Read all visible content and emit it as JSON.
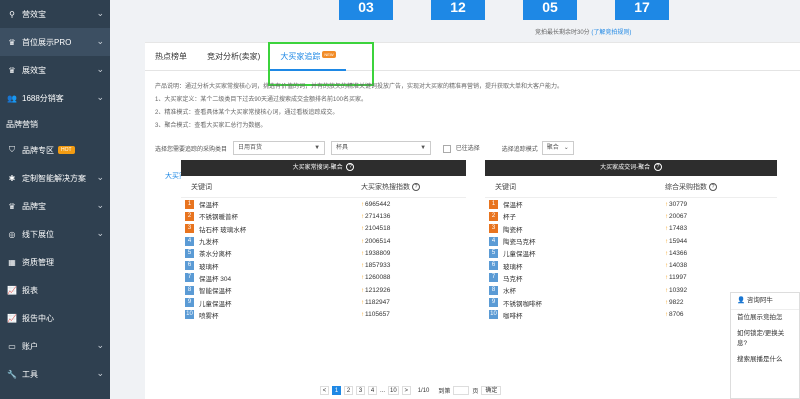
{
  "sidebar": {
    "items": [
      {
        "icon": "search-icon",
        "label": "营效宝",
        "chev": "chevron-down-icon",
        "type": "item"
      },
      {
        "icon": "crown-icon",
        "label": "首位展示PRO",
        "chev": "chevron-down-icon",
        "type": "item",
        "active": true
      },
      {
        "icon": "crown-icon",
        "label": "展效宝",
        "chev": "chevron-down-icon",
        "type": "item"
      },
      {
        "icon": "users-icon",
        "label": "1688分销客",
        "chev": "chevron-down-icon",
        "type": "item"
      },
      {
        "icon": "",
        "label": "品牌营销",
        "chev": "",
        "type": "section"
      },
      {
        "icon": "shield-icon",
        "label": "品牌专区",
        "badge": "HOT",
        "chev": "",
        "type": "item"
      },
      {
        "icon": "bulb-icon",
        "label": "定制智能解决方案",
        "chev": "chevron-down-icon",
        "type": "item"
      },
      {
        "icon": "crown-icon",
        "label": "品牌宝",
        "chev": "chevron-down-icon",
        "type": "item"
      },
      {
        "icon": "target-icon",
        "label": "线下展位",
        "chev": "chevron-down-icon",
        "type": "item"
      },
      {
        "icon": "grid-icon",
        "label": "资质管理",
        "chev": "",
        "type": "item"
      },
      {
        "icon": "chart-icon",
        "label": "报表",
        "chev": "",
        "type": "item"
      },
      {
        "icon": "chart-icon",
        "label": "报告中心",
        "chev": "",
        "type": "item"
      },
      {
        "icon": "wallet-icon",
        "label": "账户",
        "chev": "chevron-down-icon",
        "type": "item"
      },
      {
        "icon": "wrench-icon",
        "label": "工具",
        "chev": "chevron-down-icon",
        "type": "item"
      }
    ]
  },
  "timer": {
    "digits": [
      "03",
      "12",
      "05",
      "17"
    ],
    "note": "竞拍最长剩余时30分",
    "note_link": "(了解竞拍规则)"
  },
  "tabs": [
    {
      "label": "热点榜单"
    },
    {
      "label": "竞对分析(卖家)"
    },
    {
      "label": "大买家追踪",
      "badge": "NEW",
      "active": true
    }
  ],
  "description": {
    "lines": [
      "产品说明：通过分析大买家常搜核心词，挑选有价值的词，并有的放矢的精准关键词投放广告，实现对大买家的精准再营销，提升获取大单和大客户能力。",
      "1、大买家定义：某个二级类目下过去90天通过搜索成交金额排名前100名买家。",
      "2、精准模式：查看具体某个大买家常搜核心词，通过看板追踪成交。",
      "3、聚合模式：查看大买家汇总行为数据。"
    ]
  },
  "filters": {
    "label": "选择您需要追踪的采购类目",
    "category1": "日用百货",
    "category2": "杯具",
    "chk_label": "已往选择",
    "mode_label": "选择追踪模式",
    "mode_value": "聚合"
  },
  "link_text": "大买家常搜词&大买家成交词",
  "left_table": {
    "title": "大买家常搜词-聚合",
    "col1": "关键词",
    "col2": "大买家热搜指数",
    "rows": [
      {
        "rank": "1",
        "keyword": "保温杯",
        "value": "6965442"
      },
      {
        "rank": "2",
        "keyword": "不锈钢暖普杯",
        "value": "2714136"
      },
      {
        "rank": "3",
        "keyword": "钻石杯 玻璃水杯",
        "value": "2104518"
      },
      {
        "rank": "4",
        "keyword": "九发杯",
        "value": "2006514"
      },
      {
        "rank": "5",
        "keyword": "茶水分离杯",
        "value": "1938809"
      },
      {
        "rank": "6",
        "keyword": "玻璃杯",
        "value": "1857933"
      },
      {
        "rank": "7",
        "keyword": "保温杯 304",
        "value": "1260088"
      },
      {
        "rank": "8",
        "keyword": "智能保温杯",
        "value": "1212926"
      },
      {
        "rank": "9",
        "keyword": "儿童保温杯",
        "value": "1182947"
      },
      {
        "rank": "10",
        "keyword": "喷雾杯",
        "value": "1105657"
      }
    ]
  },
  "right_table": {
    "title": "大买家成交词-聚合",
    "col1": "关键词",
    "col2": "综合采购指数",
    "rows": [
      {
        "rank": "1",
        "keyword": "保温杯",
        "value": "30779"
      },
      {
        "rank": "2",
        "keyword": "杯子",
        "value": "20067"
      },
      {
        "rank": "3",
        "keyword": "陶瓷杯",
        "value": "17483"
      },
      {
        "rank": "4",
        "keyword": "陶瓷马克杯",
        "value": "15944"
      },
      {
        "rank": "5",
        "keyword": "儿童保温杯",
        "value": "14366"
      },
      {
        "rank": "6",
        "keyword": "玻璃杯",
        "value": "14038"
      },
      {
        "rank": "7",
        "keyword": "马克杯",
        "value": "11997"
      },
      {
        "rank": "8",
        "keyword": "水杯",
        "value": "10392"
      },
      {
        "rank": "9",
        "keyword": "不锈钢咖啡杯",
        "value": "9822"
      },
      {
        "rank": "10",
        "keyword": "咖啡杯",
        "value": "8706"
      }
    ]
  },
  "pager": {
    "prev": "<",
    "pages": [
      "1",
      "2",
      "3",
      "4",
      "...",
      "10"
    ],
    "next": ">",
    "total": "1/10",
    "goto_label": "到第",
    "page_unit": "页",
    "confirm": "确定"
  },
  "chat": {
    "name": "咨询阿牛",
    "lines": [
      "首位展示竞拍怎",
      "如何锁定/更换关",
      "息?",
      "搜索展播是什么"
    ]
  }
}
